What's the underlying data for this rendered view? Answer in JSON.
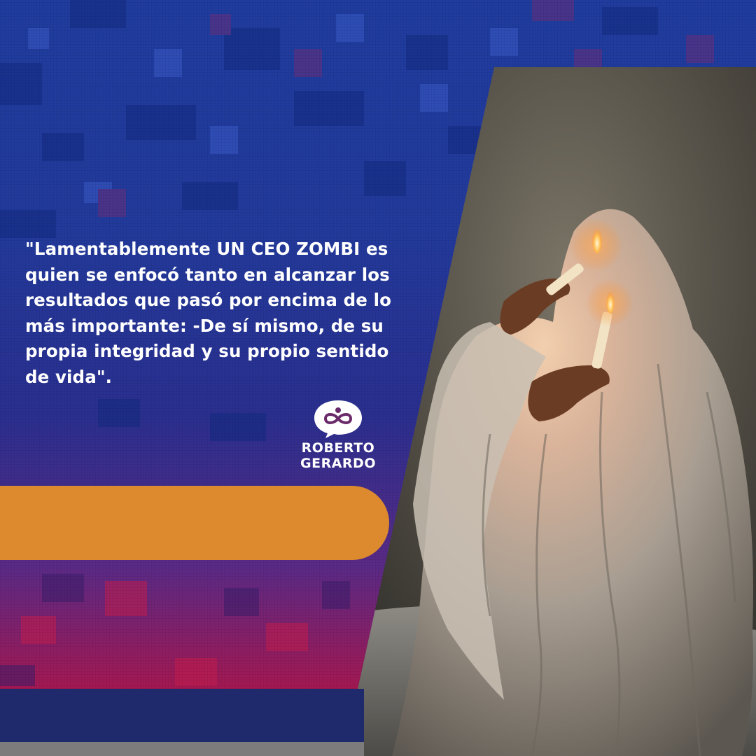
{
  "quote": {
    "text": "\"Lamentablemente UN CEO ZOMBI es quien se enfocó tanto en alcanzar los resultados que pasó por encima de lo más importante: -De sí mismo, de su propia integridad y su propio sentido de vida\"."
  },
  "logo": {
    "line1": "ROBERTO",
    "line2": "GERARDO"
  },
  "colors": {
    "accent_orange": "#dc8a2d",
    "bottom_band": "#1f2a6d",
    "text": "#ffffff"
  },
  "photo": {
    "subject": "person covered in white sheet holding two lit candles"
  }
}
